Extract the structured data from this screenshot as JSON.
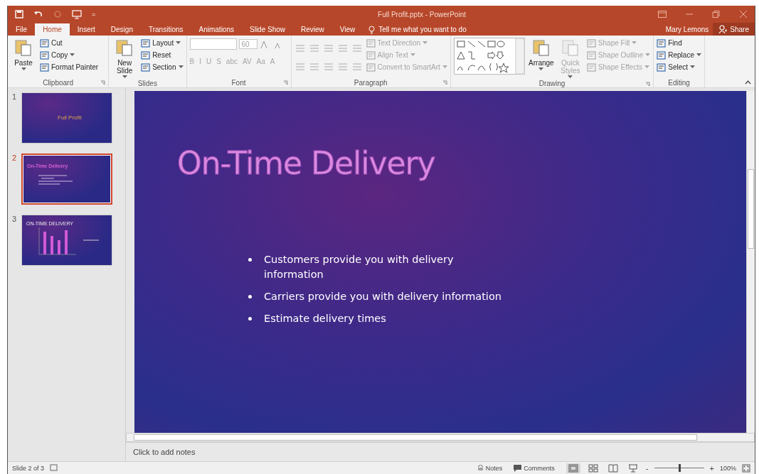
{
  "title_bar": {
    "title": "Full Profit.pptx - PowerPoint",
    "qat_more": "="
  },
  "tabs": [
    {
      "label": "File",
      "selected": false
    },
    {
      "label": "Home",
      "selected": true
    },
    {
      "label": "Insert",
      "selected": false
    },
    {
      "label": "Design",
      "selected": false
    },
    {
      "label": "Transitions",
      "selected": false
    },
    {
      "label": "Animations",
      "selected": false
    },
    {
      "label": "Slide Show",
      "selected": false
    },
    {
      "label": "Review",
      "selected": false
    },
    {
      "label": "View",
      "selected": false
    }
  ],
  "tell_me": "Tell me what you want to do",
  "user": "Mary Lemons",
  "share": "Share",
  "ribbon": {
    "groups": [
      {
        "name": "Clipboard",
        "launcher": true,
        "columns": [
          [
            {
              "kind": "large",
              "label": "Paste",
              "dropdown": true,
              "disabled": false
            }
          ],
          [
            {
              "kind": "small",
              "label": "Cut",
              "dropdown": false,
              "disabled": false
            },
            {
              "kind": "small",
              "label": "Copy",
              "dropdown": true,
              "disabled": false
            },
            {
              "kind": "small",
              "label": "Format Painter",
              "dropdown": false,
              "disabled": false
            }
          ]
        ]
      },
      {
        "name": "Slides",
        "launcher": false,
        "columns": [
          [
            {
              "kind": "large",
              "label": "New Slide",
              "dropdown": true,
              "disabled": false
            }
          ],
          [
            {
              "kind": "small",
              "label": "Layout",
              "dropdown": true,
              "disabled": false
            },
            {
              "kind": "small",
              "label": "Reset",
              "dropdown": false,
              "disabled": false
            },
            {
              "kind": "small",
              "label": "Section",
              "dropdown": true,
              "disabled": false
            }
          ]
        ]
      },
      {
        "name": "Font",
        "launcher": true,
        "columns": [
          [
            {
              "kind": "fields",
              "label": "60",
              "disabled": true
            },
            {
              "kind": "glyphs",
              "label": "B I U S abc AV Aa A",
              "disabled": true
            }
          ]
        ]
      },
      {
        "name": "Paragraph",
        "launcher": true,
        "columns": [
          [
            {
              "kind": "icons",
              "disabled": true
            },
            {
              "kind": "icons",
              "disabled": true
            }
          ],
          [
            {
              "kind": "small",
              "label": "Text Direction",
              "dropdown": true,
              "disabled": true
            },
            {
              "kind": "small",
              "label": "Align Text",
              "dropdown": true,
              "disabled": true
            },
            {
              "kind": "small",
              "label": "Convert to SmartArt",
              "dropdown": true,
              "disabled": true
            }
          ]
        ]
      },
      {
        "name": "Drawing",
        "launcher": true,
        "columns": [
          [
            {
              "kind": "gallery"
            }
          ],
          [
            {
              "kind": "large",
              "label": "Arrange",
              "dropdown": true,
              "disabled": false
            }
          ],
          [
            {
              "kind": "large",
              "label": "Quick Styles",
              "dropdown": true,
              "disabled": true
            }
          ],
          [
            {
              "kind": "small",
              "label": "Shape Fill",
              "dropdown": true,
              "disabled": true
            },
            {
              "kind": "small",
              "label": "Shape Outline",
              "dropdown": true,
              "disabled": true
            },
            {
              "kind": "small",
              "label": "Shape Effects",
              "dropdown": true,
              "disabled": true
            }
          ]
        ]
      },
      {
        "name": "Editing",
        "launcher": false,
        "columns": [
          [
            {
              "kind": "small",
              "label": "Find",
              "dropdown": false,
              "disabled": false
            },
            {
              "kind": "small",
              "label": "Replace",
              "dropdown": true,
              "disabled": false
            },
            {
              "kind": "small",
              "label": "Select",
              "dropdown": true,
              "disabled": false
            }
          ]
        ]
      }
    ]
  },
  "thumbnails": [
    {
      "number": "1",
      "title": "Full Profit",
      "selected": false,
      "kind": "title"
    },
    {
      "number": "2",
      "title": "On-Time Delivery",
      "selected": true,
      "kind": "bullets"
    },
    {
      "number": "3",
      "title": "ON-TIME DELIVERY",
      "selected": false,
      "kind": "chart"
    }
  ],
  "slide": {
    "title": "On-Time Delivery",
    "bullets": [
      "Customers provide you with delivery information",
      "Carriers provide you with delivery information",
      "Estimate delivery times"
    ]
  },
  "notes": {
    "placeholder": "Click to add notes"
  },
  "status_bar": {
    "slide_info": "Slide 2 of 3",
    "notes": "Notes",
    "comments": "Comments",
    "zoom": "100%",
    "zoom_minus": "-",
    "zoom_plus": "+",
    "zoom_slider": {
      "level": 0.5
    }
  }
}
